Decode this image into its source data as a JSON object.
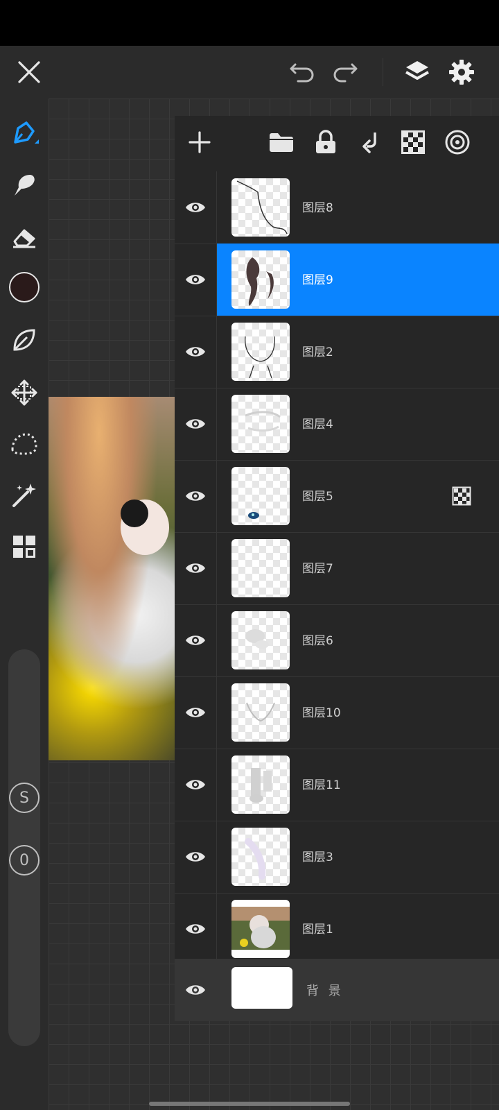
{
  "window": {
    "title": ""
  },
  "topbar": {
    "close_icon": "close-icon",
    "undo_icon": "undo-icon",
    "redo_icon": "redo-icon",
    "layers_icon": "layers-icon",
    "settings_icon": "gear-icon"
  },
  "tools": [
    {
      "id": "pen",
      "icon": "pen-icon",
      "active": true
    },
    {
      "id": "smudge",
      "icon": "smudge-icon"
    },
    {
      "id": "eraser",
      "icon": "eraser-icon"
    },
    {
      "id": "color",
      "icon": "color-swatch",
      "color": "#2a1a1a"
    },
    {
      "id": "leaf",
      "icon": "leaf-icon"
    },
    {
      "id": "move",
      "icon": "move-icon"
    },
    {
      "id": "lasso",
      "icon": "lasso-icon"
    },
    {
      "id": "magic",
      "icon": "magic-wand-icon"
    },
    {
      "id": "grid",
      "icon": "grid-icon"
    }
  ],
  "slider": {
    "size_label": "S",
    "opacity_label": "0"
  },
  "layers_toolbar": {
    "add_icon": "plus-icon",
    "folder_icon": "folder-icon",
    "lock_icon": "lock-icon",
    "merge_icon": "merge-down-icon",
    "alpha_icon": "checker-icon",
    "blend_icon": "target-icon"
  },
  "layers": [
    {
      "name": "图层8",
      "visible": true,
      "selected": false
    },
    {
      "name": "图层9",
      "visible": true,
      "selected": true
    },
    {
      "name": "图层2",
      "visible": true,
      "selected": false
    },
    {
      "name": "图层4",
      "visible": true,
      "selected": false
    },
    {
      "name": "图层5",
      "visible": true,
      "selected": false,
      "alpha_lock": true
    },
    {
      "name": "图层7",
      "visible": true,
      "selected": false
    },
    {
      "name": "图层6",
      "visible": true,
      "selected": false
    },
    {
      "name": "图层10",
      "visible": true,
      "selected": false
    },
    {
      "name": "图层11",
      "visible": true,
      "selected": false
    },
    {
      "name": "图层3",
      "visible": true,
      "selected": false
    },
    {
      "name": "图层1",
      "visible": true,
      "selected": false
    }
  ],
  "background_layer": {
    "name": "背 景",
    "visible": true
  },
  "colors": {
    "accent": "#0a84ff",
    "panel": "#262626",
    "toolbar": "#2b2b2b"
  }
}
